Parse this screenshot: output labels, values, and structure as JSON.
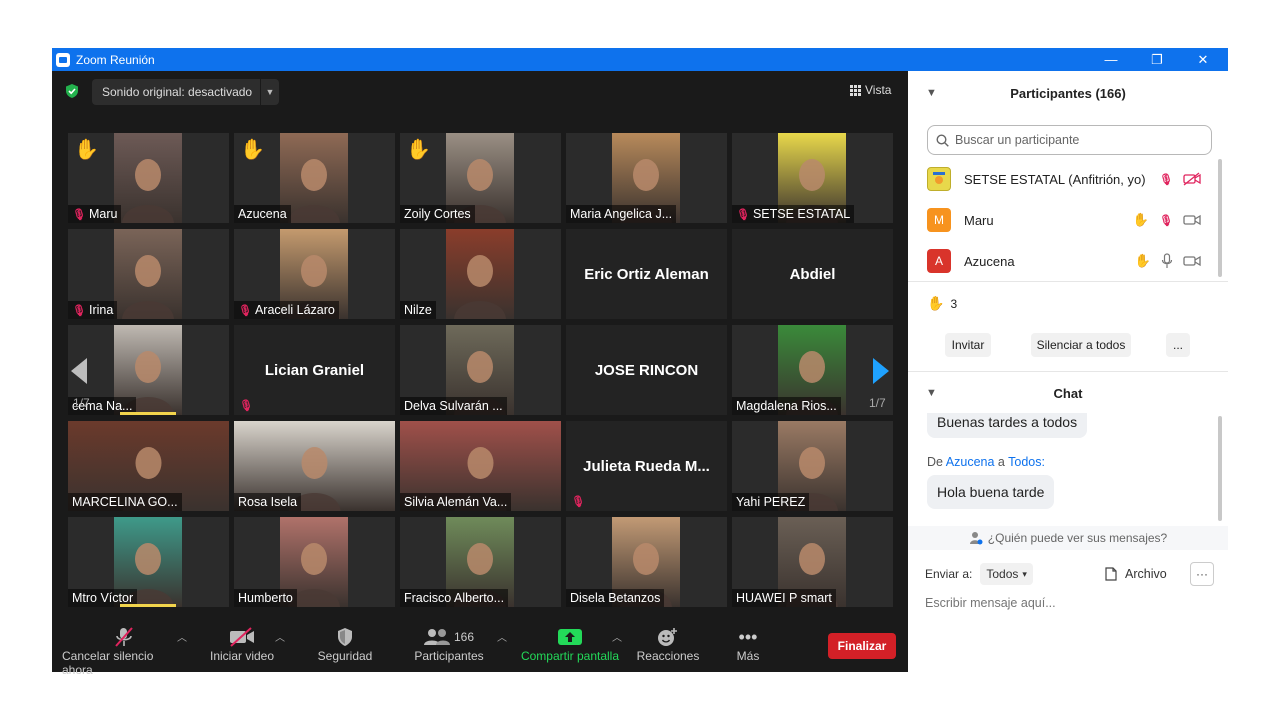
{
  "window": {
    "title": "Zoom Reunión",
    "min": "—",
    "restore": "❐",
    "close": "✕"
  },
  "topbar": {
    "sound_label": "Sonido original: desactivado",
    "view_label": "Vista"
  },
  "tiles": [
    {
      "name": "Maru",
      "hand": true,
      "muted": true,
      "bg": "#2b2b2b",
      "photo": "#6d5a56"
    },
    {
      "name": "Azucena",
      "hand": true,
      "muted": false,
      "bg": "#2b2b2b",
      "photo": "#8f6a55"
    },
    {
      "name": "Zoily Cortes",
      "hand": true,
      "muted": false,
      "bg": "#2b2b2b",
      "photo": "#9a8f84"
    },
    {
      "name": "Maria Angelica J...",
      "hand": false,
      "muted": false,
      "bg": "#2b2b2b",
      "photo": "#b88a5b"
    },
    {
      "name": "SETSE ESTATAL",
      "hand": false,
      "muted": true,
      "bg": "#2b2b2b",
      "photo": "#e8d84b"
    },
    {
      "name": "Irina",
      "hand": false,
      "muted": true,
      "bg": "#2b2b2b",
      "photo": "#7a6458"
    },
    {
      "name": "Araceli Lázaro",
      "hand": false,
      "muted": true,
      "bg": "#2b2b2b",
      "photo": "#c49a6e"
    },
    {
      "name": "Nilze",
      "hand": false,
      "muted": false,
      "bg": "#2b2b2b",
      "photo": "#8a3d2b"
    },
    {
      "big": "Eric Ortiz Aleman"
    },
    {
      "big": "Abdiel"
    },
    {
      "name": "cema Na...",
      "hand": false,
      "muted": false,
      "bg": "#2b2b2b",
      "photo": "#bfb9b2",
      "speaking": true
    },
    {
      "big": "Lician Graniel",
      "muted_only": true
    },
    {
      "name": "Delva Sulvarán ...",
      "hand": false,
      "muted": false,
      "bg": "#2b2b2b",
      "photo": "#6e6a5a"
    },
    {
      "big": "JOSE RINCON"
    },
    {
      "name": "Magdalena Rios...",
      "hand": false,
      "muted": false,
      "bg": "#2b2b2b",
      "photo": "#3a8a3a"
    },
    {
      "name": "MARCELINA GO...",
      "hand": false,
      "muted": false,
      "bg": "#6b3a2c",
      "photo": "#6b3a2c",
      "wide": true
    },
    {
      "name": "Rosa Isela",
      "hand": false,
      "muted": false,
      "bg": "#d9d4cc",
      "photo": "#d9d4cc",
      "wide": true
    },
    {
      "name": "Silvia Alemán Va...",
      "hand": false,
      "muted": false,
      "bg": "#a0504a",
      "photo": "#a0504a",
      "wide": true
    },
    {
      "big": "Julieta  Rueda  M...",
      "muted_only": true
    },
    {
      "name": "Yahi PEREZ",
      "hand": false,
      "muted": false,
      "bg": "#2b2b2b",
      "photo": "#9a7a64"
    },
    {
      "name": "Mtro Víctor",
      "hand": false,
      "muted": false,
      "bg": "#2b2b2b",
      "photo": "#3e9a8a",
      "speaking": true
    },
    {
      "name": "Humberto",
      "hand": false,
      "muted": false,
      "bg": "#2b2b2b",
      "photo": "#b0726a"
    },
    {
      "name": "Fracisco Alberto...",
      "hand": false,
      "muted": false,
      "bg": "#2b2b2b",
      "photo": "#6f8b5a"
    },
    {
      "name": "Disela Betanzos",
      "hand": false,
      "muted": false,
      "bg": "#2b2b2b",
      "photo": "#c29a75"
    },
    {
      "name": "HUAWEI P smart",
      "hand": false,
      "muted": false,
      "bg": "#2b2b2b",
      "photo": "#6a5f55"
    }
  ],
  "pager": {
    "left": "1/7",
    "right": "1/7"
  },
  "toolbar": {
    "mute": "Cancelar silencio ahora",
    "video": "Iniciar video",
    "security": "Seguridad",
    "participants": "Participantes",
    "participants_count": "166",
    "share": "Compartir pantalla",
    "reactions": "Reacciones",
    "more": "Más",
    "end": "Finalizar"
  },
  "participants_panel": {
    "title": "Participantes (166)",
    "search_placeholder": "Buscar un participante",
    "list": [
      {
        "name": "SETSE ESTATAL (Anfitrión, yo)",
        "avatar": "",
        "color": "#e8d84b"
      },
      {
        "name": "Maru",
        "avatar": "M",
        "color": "#f7931e"
      },
      {
        "name": "Azucena",
        "avatar": "A",
        "color": "#d9342b"
      }
    ],
    "hands_count": "3",
    "invite": "Invitar",
    "mute_all": "Silenciar a todos",
    "more": "..."
  },
  "chat": {
    "title": "Chat",
    "msg1": "Buenas tardes a todos",
    "from_prefix": "De",
    "from_name": "Azucena",
    "to_prefix": "a",
    "to_name": "Todos:",
    "msg2": "Hola buena tarde",
    "who_can_see": "¿Quién puede ver sus mensajes?",
    "send_to": "Enviar a:",
    "send_to_value": "Todos",
    "file": "Archivo",
    "input_placeholder": "Escribir mensaje aquí..."
  },
  "colors": {
    "accent": "#0e72ed",
    "end": "#d32027",
    "share": "#23d959",
    "muted": "#e0245e"
  }
}
